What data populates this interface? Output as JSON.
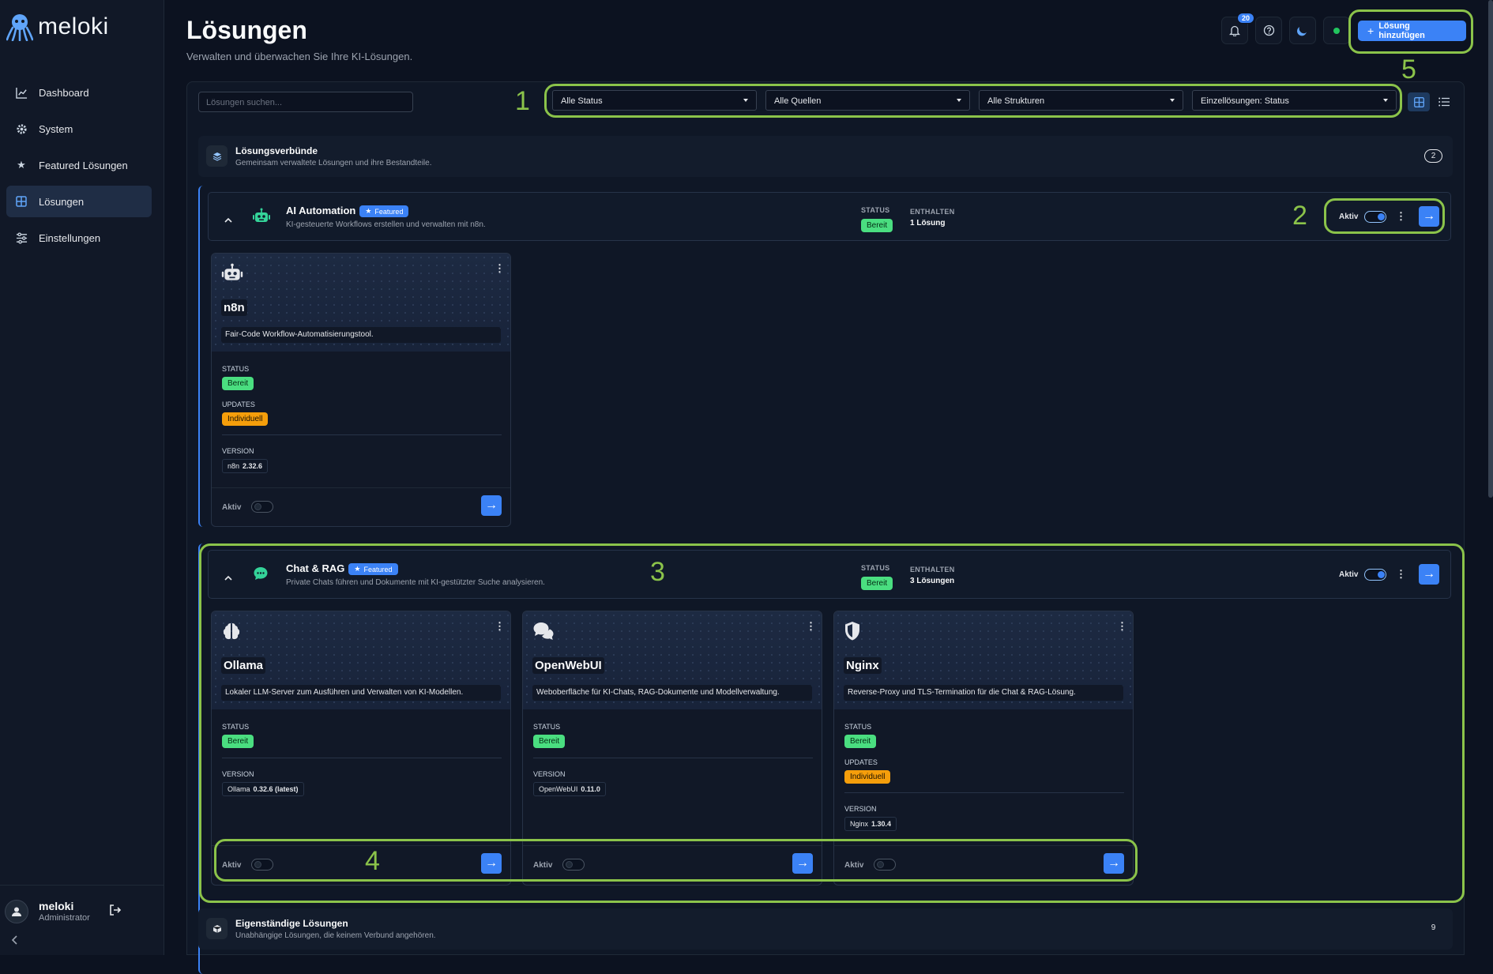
{
  "app": {
    "name": "meloki"
  },
  "sidebar": {
    "items": [
      {
        "label": "Dashboard",
        "icon": "chart-line-icon"
      },
      {
        "label": "System",
        "icon": "gear-icon"
      },
      {
        "label": "Featured Lösungen",
        "icon": "star-icon"
      },
      {
        "label": "Lösungen",
        "icon": "grid-icon",
        "active": true
      },
      {
        "label": "Einstellungen",
        "icon": "sliders-icon"
      }
    ],
    "user": {
      "name": "meloki",
      "role": "Administrator"
    }
  },
  "header": {
    "title": "Lösungen",
    "subtitle": "Verwalten und überwachen Sie Ihre KI-Lösungen.",
    "notification_count": "20",
    "add_button": "Lösung hinzufügen"
  },
  "toolbar": {
    "search_placeholder": "Lösungen suchen...",
    "filters": [
      "Alle Status",
      "Alle Quellen",
      "Alle Strukturen",
      "Einzellösungen: Status"
    ]
  },
  "section_bundles": {
    "title": "Lösungsverbünde",
    "subtitle": "Gemeinsam verwaltete Lösungen und ihre Bestandteile.",
    "count": "2"
  },
  "bundles": [
    {
      "name": "AI Automation",
      "featured_label": "Featured",
      "description": "KI-gesteuerte Workflows erstellen und verwalten mit n8n.",
      "status_label": "STATUS",
      "status": "Bereit",
      "contains_label": "ENTHALTEN",
      "contains": "1 Lösung",
      "active_label": "Aktiv",
      "cards": [
        {
          "name": "n8n",
          "description": "Fair-Code Workflow-Automatisierungstool.",
          "status_label": "STATUS",
          "status": "Bereit",
          "updates_label": "UPDATES",
          "updates": "Individuell",
          "version_label": "VERSION",
          "version_name": "n8n",
          "version": "2.32.6",
          "active_label": "Aktiv",
          "icon": "robot-icon"
        }
      ]
    },
    {
      "name": "Chat & RAG",
      "featured_label": "Featured",
      "description": "Private Chats führen und Dokumente mit KI-gestützter Suche analysieren.",
      "status_label": "STATUS",
      "status": "Bereit",
      "contains_label": "ENTHALTEN",
      "contains": "3 Lösungen",
      "active_label": "Aktiv",
      "cards": [
        {
          "name": "Ollama",
          "description": "Lokaler LLM-Server zum Ausführen und Verwalten von KI-Modellen.",
          "status_label": "STATUS",
          "status": "Bereit",
          "version_label": "VERSION",
          "version_name": "Ollama",
          "version": "0.32.6 (latest)",
          "active_label": "Aktiv",
          "icon": "brain-icon"
        },
        {
          "name": "OpenWebUI",
          "description": "Weboberfläche für KI-Chats, RAG-Dokumente und Modellverwaltung.",
          "status_label": "STATUS",
          "status": "Bereit",
          "version_label": "VERSION",
          "version_name": "OpenWebUI",
          "version": "0.11.0",
          "active_label": "Aktiv",
          "icon": "chat-bubbles-icon"
        },
        {
          "name": "Nginx",
          "description": "Reverse-Proxy und TLS-Termination für die Chat & RAG-Lösung.",
          "status_label": "STATUS",
          "status": "Bereit",
          "updates_label": "UPDATES",
          "updates": "Individuell",
          "version_label": "VERSION",
          "version_name": "Nginx",
          "version": "1.30.4",
          "active_label": "Aktiv",
          "icon": "shield-icon"
        }
      ]
    }
  ],
  "section_standalone": {
    "title": "Eigenständige Lösungen",
    "subtitle": "Unabhängige Lösungen, die keinem Verbund angehören.",
    "count": "9"
  },
  "annotations": [
    "1",
    "2",
    "3",
    "4",
    "5"
  ],
  "colors": {
    "accent": "#3b82f6",
    "annotation": "#8bc34a",
    "ready": "#4ade80",
    "custom": "#f59e0b"
  }
}
